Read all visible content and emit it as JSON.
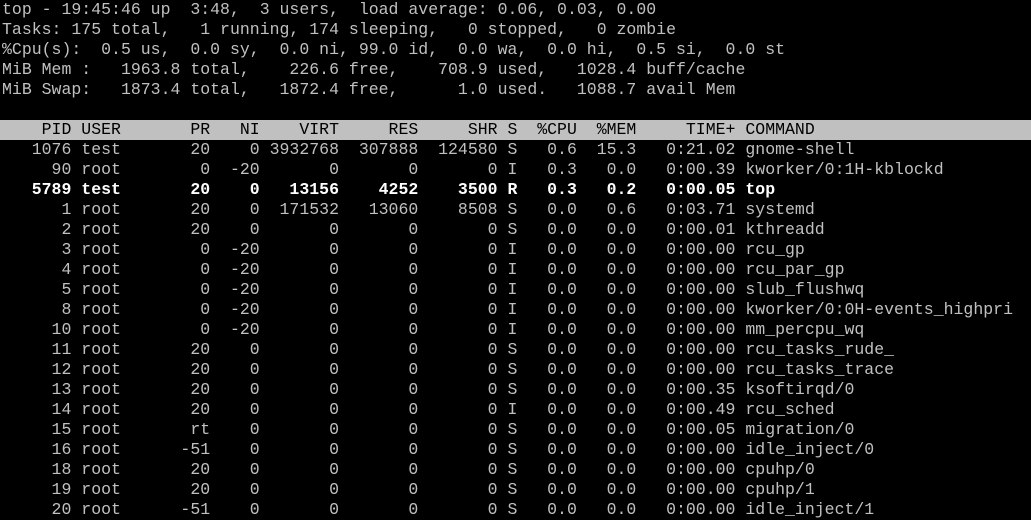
{
  "colors": {
    "background": "#000000",
    "text": "#c0c0c0",
    "header_bg": "#c0c0c0",
    "header_text": "#000000",
    "highlight": "#ffffff"
  },
  "summary": {
    "uptime": "top - 19:45:46 up  3:48,  3 users,  load average: 0.06, 0.03, 0.00",
    "tasks": "Tasks: 175 total,   1 running, 174 sleeping,   0 stopped,   0 zombie",
    "cpu": "%Cpu(s):  0.5 us,  0.0 sy,  0.0 ni, 99.0 id,  0.0 wa,  0.0 hi,  0.5 si,  0.0 st",
    "mem": "MiB Mem :   1963.8 total,    226.6 free,    708.9 used,   1028.4 buff/cache",
    "swap": "MiB Swap:   1873.4 total,   1872.4 free,      1.0 used.   1088.7 avail Mem"
  },
  "columns": [
    "PID",
    "USER",
    "PR",
    "NI",
    "VIRT",
    "RES",
    "SHR",
    "S",
    "%CPU",
    "%MEM",
    "TIME+",
    "COMMAND"
  ],
  "processes": [
    {
      "pid": "1076",
      "user": "test",
      "pr": "20",
      "ni": "0",
      "virt": "3932768",
      "res": "307888",
      "shr": "124580",
      "s": "S",
      "cpu": "0.6",
      "mem": "15.3",
      "time": "0:21.02",
      "command": "gnome-shell",
      "highlight": false
    },
    {
      "pid": "90",
      "user": "root",
      "pr": "0",
      "ni": "-20",
      "virt": "0",
      "res": "0",
      "shr": "0",
      "s": "I",
      "cpu": "0.3",
      "mem": "0.0",
      "time": "0:00.39",
      "command": "kworker/0:1H-kblockd",
      "highlight": false
    },
    {
      "pid": "5789",
      "user": "test",
      "pr": "20",
      "ni": "0",
      "virt": "13156",
      "res": "4252",
      "shr": "3500",
      "s": "R",
      "cpu": "0.3",
      "mem": "0.2",
      "time": "0:00.05",
      "command": "top",
      "highlight": true
    },
    {
      "pid": "1",
      "user": "root",
      "pr": "20",
      "ni": "0",
      "virt": "171532",
      "res": "13060",
      "shr": "8508",
      "s": "S",
      "cpu": "0.0",
      "mem": "0.6",
      "time": "0:03.71",
      "command": "systemd",
      "highlight": false
    },
    {
      "pid": "2",
      "user": "root",
      "pr": "20",
      "ni": "0",
      "virt": "0",
      "res": "0",
      "shr": "0",
      "s": "S",
      "cpu": "0.0",
      "mem": "0.0",
      "time": "0:00.01",
      "command": "kthreadd",
      "highlight": false
    },
    {
      "pid": "3",
      "user": "root",
      "pr": "0",
      "ni": "-20",
      "virt": "0",
      "res": "0",
      "shr": "0",
      "s": "I",
      "cpu": "0.0",
      "mem": "0.0",
      "time": "0:00.00",
      "command": "rcu_gp",
      "highlight": false
    },
    {
      "pid": "4",
      "user": "root",
      "pr": "0",
      "ni": "-20",
      "virt": "0",
      "res": "0",
      "shr": "0",
      "s": "I",
      "cpu": "0.0",
      "mem": "0.0",
      "time": "0:00.00",
      "command": "rcu_par_gp",
      "highlight": false
    },
    {
      "pid": "5",
      "user": "root",
      "pr": "0",
      "ni": "-20",
      "virt": "0",
      "res": "0",
      "shr": "0",
      "s": "I",
      "cpu": "0.0",
      "mem": "0.0",
      "time": "0:00.00",
      "command": "slub_flushwq",
      "highlight": false
    },
    {
      "pid": "8",
      "user": "root",
      "pr": "0",
      "ni": "-20",
      "virt": "0",
      "res": "0",
      "shr": "0",
      "s": "I",
      "cpu": "0.0",
      "mem": "0.0",
      "time": "0:00.00",
      "command": "kworker/0:0H-events_highpri",
      "highlight": false
    },
    {
      "pid": "10",
      "user": "root",
      "pr": "0",
      "ni": "-20",
      "virt": "0",
      "res": "0",
      "shr": "0",
      "s": "I",
      "cpu": "0.0",
      "mem": "0.0",
      "time": "0:00.00",
      "command": "mm_percpu_wq",
      "highlight": false
    },
    {
      "pid": "11",
      "user": "root",
      "pr": "20",
      "ni": "0",
      "virt": "0",
      "res": "0",
      "shr": "0",
      "s": "S",
      "cpu": "0.0",
      "mem": "0.0",
      "time": "0:00.00",
      "command": "rcu_tasks_rude_",
      "highlight": false
    },
    {
      "pid": "12",
      "user": "root",
      "pr": "20",
      "ni": "0",
      "virt": "0",
      "res": "0",
      "shr": "0",
      "s": "S",
      "cpu": "0.0",
      "mem": "0.0",
      "time": "0:00.00",
      "command": "rcu_tasks_trace",
      "highlight": false
    },
    {
      "pid": "13",
      "user": "root",
      "pr": "20",
      "ni": "0",
      "virt": "0",
      "res": "0",
      "shr": "0",
      "s": "S",
      "cpu": "0.0",
      "mem": "0.0",
      "time": "0:00.35",
      "command": "ksoftirqd/0",
      "highlight": false
    },
    {
      "pid": "14",
      "user": "root",
      "pr": "20",
      "ni": "0",
      "virt": "0",
      "res": "0",
      "shr": "0",
      "s": "I",
      "cpu": "0.0",
      "mem": "0.0",
      "time": "0:00.49",
      "command": "rcu_sched",
      "highlight": false
    },
    {
      "pid": "15",
      "user": "root",
      "pr": "rt",
      "ni": "0",
      "virt": "0",
      "res": "0",
      "shr": "0",
      "s": "S",
      "cpu": "0.0",
      "mem": "0.0",
      "time": "0:00.05",
      "command": "migration/0",
      "highlight": false
    },
    {
      "pid": "16",
      "user": "root",
      "pr": "-51",
      "ni": "0",
      "virt": "0",
      "res": "0",
      "shr": "0",
      "s": "S",
      "cpu": "0.0",
      "mem": "0.0",
      "time": "0:00.00",
      "command": "idle_inject/0",
      "highlight": false
    },
    {
      "pid": "18",
      "user": "root",
      "pr": "20",
      "ni": "0",
      "virt": "0",
      "res": "0",
      "shr": "0",
      "s": "S",
      "cpu": "0.0",
      "mem": "0.0",
      "time": "0:00.00",
      "command": "cpuhp/0",
      "highlight": false
    },
    {
      "pid": "19",
      "user": "root",
      "pr": "20",
      "ni": "0",
      "virt": "0",
      "res": "0",
      "shr": "0",
      "s": "S",
      "cpu": "0.0",
      "mem": "0.0",
      "time": "0:00.00",
      "command": "cpuhp/1",
      "highlight": false
    },
    {
      "pid": "20",
      "user": "root",
      "pr": "-51",
      "ni": "0",
      "virt": "0",
      "res": "0",
      "shr": "0",
      "s": "S",
      "cpu": "0.0",
      "mem": "0.0",
      "time": "0:00.00",
      "command": "idle_inject/1",
      "highlight": false
    }
  ]
}
